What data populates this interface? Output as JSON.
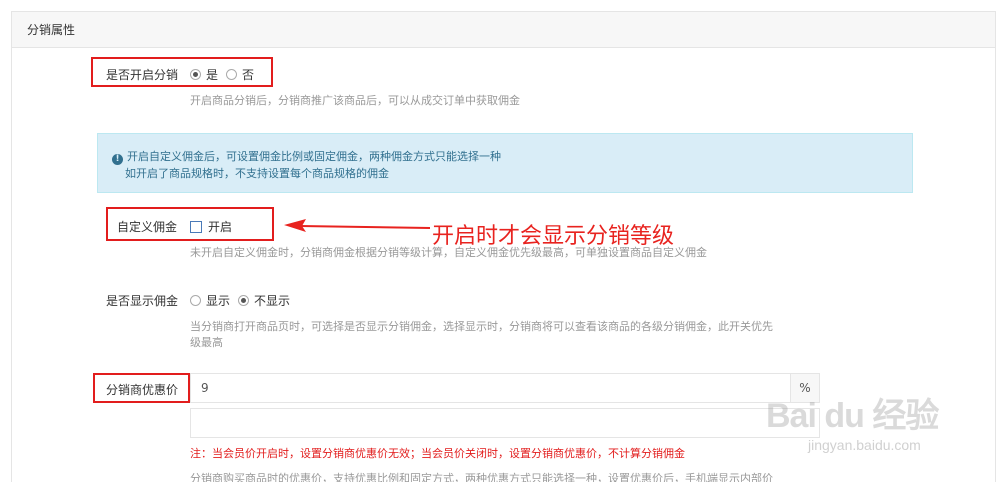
{
  "panel": {
    "title": "分销属性"
  },
  "enable_distribution": {
    "label": "是否开启分销",
    "options": [
      "是",
      "否"
    ],
    "selected": "是",
    "help": "开启商品分销后，分销商推广该商品后，可以从成交订单中获取佣金"
  },
  "alert": {
    "line1": "开启自定义佣金后，可设置佣金比例或固定佣金，两种佣金方式只能选择一种",
    "line2": "如开启了商品规格时，不支持设置每个商品规格的佣金"
  },
  "custom_commission": {
    "label": "自定义佣金",
    "checkbox_label": "开启",
    "checked": false,
    "help": "未开启自定义佣金时，分销商佣金根据分销等级计算，自定义佣金优先级最高，可单独设置商品自定义佣金"
  },
  "annotation": {
    "text": "开启时才会显示分销等级",
    "color": "#e8231f"
  },
  "show_commission": {
    "label": "是否显示佣金",
    "options": [
      "显示",
      "不显示"
    ],
    "selected": "不显示",
    "help_line1": "当分销商打开商品页时，可选择是否显示分销佣金，选择显示时，分销商将可以查看该商品的各级分销佣金，此开关优先",
    "help_line2": "级最高"
  },
  "discount_price": {
    "label": "分销商优惠价",
    "value": "9",
    "unit": "%",
    "note": "注：当会员价开启时，设置分销商优惠价无效；当会员价关闭时，设置分销商优惠价，不计算分销佣金",
    "help": "分销商购买商品时的优惠价，支持优惠比例和固定方式，两种优惠方式只能选择一种，设置优惠价后，手机端显示内部价"
  },
  "watermark": {
    "logo": "Bai du 经验",
    "url": "jingyan.baidu.com"
  },
  "colors": {
    "highlight_red": "#e21d1d",
    "alert_bg": "#d9edf7",
    "alert_text": "#31708f"
  }
}
